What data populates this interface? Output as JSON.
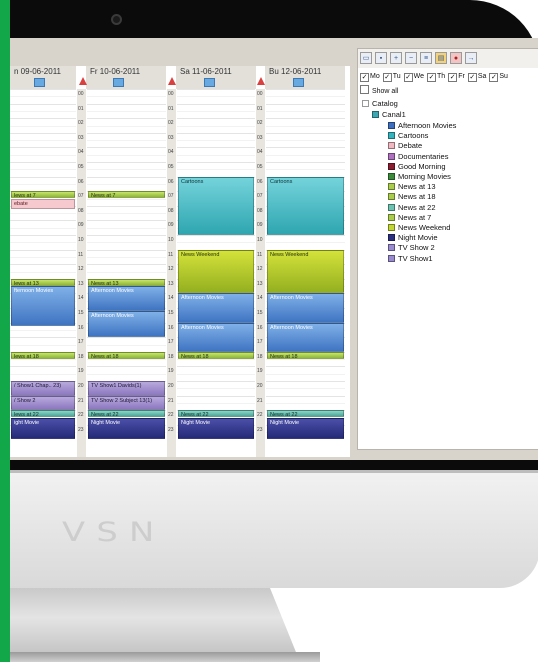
{
  "brand": "VSN",
  "days": [
    {
      "label": "n 09-06-2011"
    },
    {
      "label": "Fr 10-06-2011"
    },
    {
      "label": "Sa 11-06-2011"
    },
    {
      "label": "Bu 12-06-2011"
    }
  ],
  "hours": [
    "00",
    "01",
    "02",
    "03",
    "04",
    "05",
    "06",
    "07",
    "08",
    "09",
    "10",
    "11",
    "12",
    "13",
    "14",
    "15",
    "16",
    "17",
    "18",
    "19",
    "20",
    "21",
    "22",
    "23"
  ],
  "events": {
    "col0": [
      {
        "text": "lews at 7",
        "cls": "news"
      },
      {
        "text": "ebate",
        "cls": "pink"
      },
      {
        "text": "lews at 13",
        "cls": "news"
      },
      {
        "text": "fternoon Movies",
        "cls": "blue"
      },
      {
        "text": "lews at 18",
        "cls": "news"
      },
      {
        "text": "/ Show1 Chap.. 23)",
        "cls": "lav"
      },
      {
        "text": "/ Show 2",
        "cls": "lav"
      },
      {
        "text": "lews at 22",
        "cls": "sea"
      },
      {
        "text": "ight Movie",
        "cls": "navy"
      }
    ],
    "col1": [
      {
        "text": "News at 7",
        "cls": "news"
      },
      {
        "text": "News at 13",
        "cls": "news"
      },
      {
        "text": "Afternoon Movies",
        "cls": "blue"
      },
      {
        "text": "Afternoon Movies",
        "cls": "blue"
      },
      {
        "text": "News at 18",
        "cls": "news"
      },
      {
        "text": "TV Show1 Davids(1)",
        "cls": "lav"
      },
      {
        "text": "TV Show 2 Subject 13(1)",
        "cls": "lav"
      },
      {
        "text": "News at 22",
        "cls": "sea"
      },
      {
        "text": "Night Movie",
        "cls": "navy"
      }
    ],
    "col2": [
      {
        "text": "Cartoons",
        "cls": "teal"
      },
      {
        "text": "News Weekend",
        "cls": "olive"
      },
      {
        "text": "Afternoon Movies",
        "cls": "blue"
      },
      {
        "text": "Afternoon Movies",
        "cls": "blue"
      },
      {
        "text": "News at 18",
        "cls": "news"
      },
      {
        "text": "News at 22",
        "cls": "sea"
      },
      {
        "text": "Night Movie",
        "cls": "navy"
      }
    ],
    "col3": [
      {
        "text": "Cartoons",
        "cls": "teal"
      },
      {
        "text": "News Weekend",
        "cls": "olive"
      },
      {
        "text": "Afternoon Movies",
        "cls": "blue"
      },
      {
        "text": "Afternoon Movies",
        "cls": "blue"
      },
      {
        "text": "News at 18",
        "cls": "news"
      },
      {
        "text": "News at 22",
        "cls": "sea"
      },
      {
        "text": "Night Movie",
        "cls": "navy"
      }
    ]
  },
  "panel": {
    "weekdays": [
      {
        "label": "Mo",
        "checked": true
      },
      {
        "label": "Tu",
        "checked": true
      },
      {
        "label": "We",
        "checked": true
      },
      {
        "label": "Th",
        "checked": true
      },
      {
        "label": "Fr",
        "checked": true
      },
      {
        "label": "Sa",
        "checked": true
      },
      {
        "label": "Su",
        "checked": true
      }
    ],
    "show_all": "Show all",
    "catalog": "Catalog",
    "channel": "Canal1",
    "programs": [
      {
        "name": "Afternoon Movies",
        "color": "#3d6fc0"
      },
      {
        "name": "Cartoons",
        "color": "#33b3bd"
      },
      {
        "name": "Debate",
        "color": "#f0b8c0"
      },
      {
        "name": "Documentaries",
        "color": "#b070c0"
      },
      {
        "name": "Good Morning",
        "color": "#8a1c30"
      },
      {
        "name": "Morning Movies",
        "color": "#3a8a3a"
      },
      {
        "name": "News at 13",
        "color": "#a9cd4a"
      },
      {
        "name": "News at 18",
        "color": "#a9cd4a"
      },
      {
        "name": "News at 22",
        "color": "#6cc3b0"
      },
      {
        "name": "News at 7",
        "color": "#a9cd4a"
      },
      {
        "name": "News Weekend",
        "color": "#c1d630"
      },
      {
        "name": "Night Movie",
        "color": "#2a2f80"
      },
      {
        "name": "TV Show 2",
        "color": "#9a8ad0"
      },
      {
        "name": "TV Show1",
        "color": "#9a8ad0"
      }
    ]
  }
}
